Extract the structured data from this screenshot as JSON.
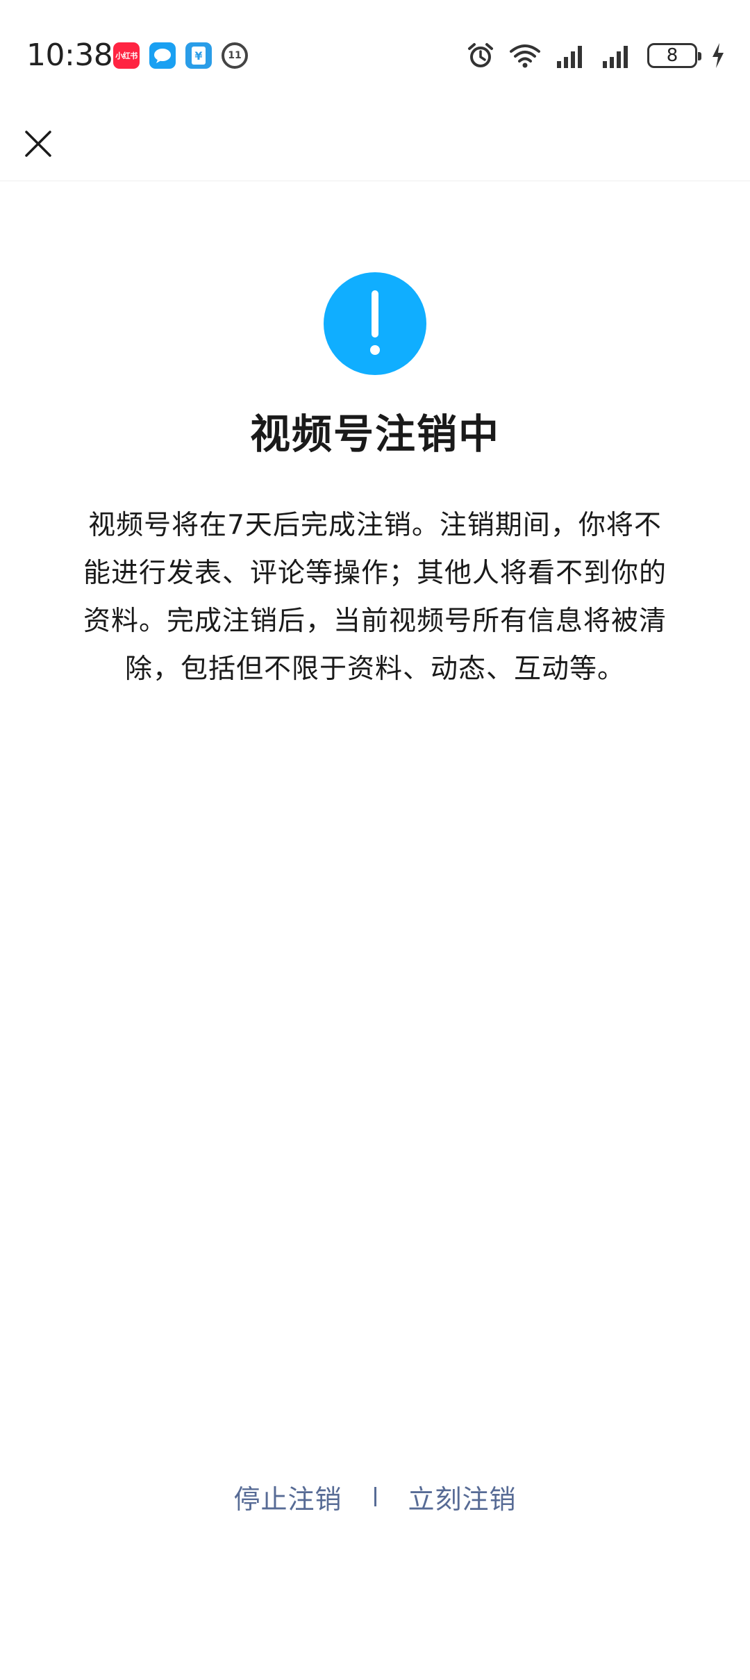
{
  "status_bar": {
    "time": "10:38",
    "notification_apps": [
      {
        "name": "xiaohongshu-icon",
        "label": "小红书",
        "color": "#ff2442"
      },
      {
        "name": "chat-bubble-icon",
        "color": "#1aa0f2"
      },
      {
        "name": "yuan-wallet-icon",
        "label": "¥",
        "color": "#2a9de8"
      },
      {
        "name": "circle-app-icon",
        "label": "11"
      }
    ],
    "battery_level": "8"
  },
  "nav": {
    "close_icon": "close-icon"
  },
  "main": {
    "alert_icon": "exclamation-icon",
    "alert_color": "#10aeff",
    "title": "视频号注销中",
    "description_lines": [
      "视频号将在7天后完成注销。注销期间，你将不",
      "能进行发表、评论等操作；其他人将看不到你的",
      "资料。完成注销后，当前视频号所有信息将被清",
      "除，包括但不限于资料、动态、互动等。"
    ]
  },
  "actions": {
    "stop_label": "停止注销",
    "immediate_label": "立刻注销",
    "link_color": "#576b95"
  }
}
